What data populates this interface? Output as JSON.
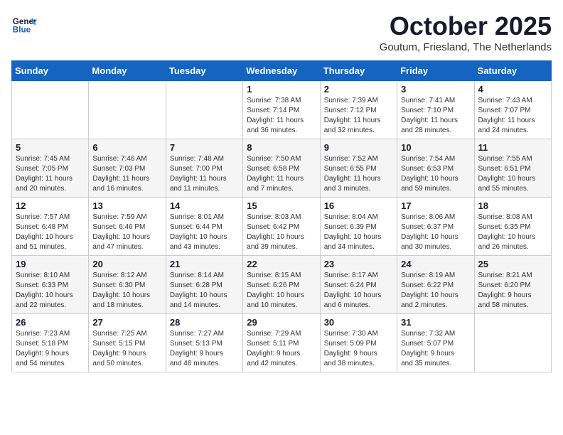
{
  "logo": {
    "line1": "General",
    "line2": "Blue"
  },
  "title": "October 2025",
  "location": "Goutum, Friesland, The Netherlands",
  "days_of_week": [
    "Sunday",
    "Monday",
    "Tuesday",
    "Wednesday",
    "Thursday",
    "Friday",
    "Saturday"
  ],
  "weeks": [
    [
      {
        "num": "",
        "info": ""
      },
      {
        "num": "",
        "info": ""
      },
      {
        "num": "",
        "info": ""
      },
      {
        "num": "1",
        "info": "Sunrise: 7:38 AM\nSunset: 7:14 PM\nDaylight: 11 hours\nand 36 minutes."
      },
      {
        "num": "2",
        "info": "Sunrise: 7:39 AM\nSunset: 7:12 PM\nDaylight: 11 hours\nand 32 minutes."
      },
      {
        "num": "3",
        "info": "Sunrise: 7:41 AM\nSunset: 7:10 PM\nDaylight: 11 hours\nand 28 minutes."
      },
      {
        "num": "4",
        "info": "Sunrise: 7:43 AM\nSunset: 7:07 PM\nDaylight: 11 hours\nand 24 minutes."
      }
    ],
    [
      {
        "num": "5",
        "info": "Sunrise: 7:45 AM\nSunset: 7:05 PM\nDaylight: 11 hours\nand 20 minutes."
      },
      {
        "num": "6",
        "info": "Sunrise: 7:46 AM\nSunset: 7:03 PM\nDaylight: 11 hours\nand 16 minutes."
      },
      {
        "num": "7",
        "info": "Sunrise: 7:48 AM\nSunset: 7:00 PM\nDaylight: 11 hours\nand 11 minutes."
      },
      {
        "num": "8",
        "info": "Sunrise: 7:50 AM\nSunset: 6:58 PM\nDaylight: 11 hours\nand 7 minutes."
      },
      {
        "num": "9",
        "info": "Sunrise: 7:52 AM\nSunset: 6:55 PM\nDaylight: 11 hours\nand 3 minutes."
      },
      {
        "num": "10",
        "info": "Sunrise: 7:54 AM\nSunset: 6:53 PM\nDaylight: 10 hours\nand 59 minutes."
      },
      {
        "num": "11",
        "info": "Sunrise: 7:55 AM\nSunset: 6:51 PM\nDaylight: 10 hours\nand 55 minutes."
      }
    ],
    [
      {
        "num": "12",
        "info": "Sunrise: 7:57 AM\nSunset: 6:48 PM\nDaylight: 10 hours\nand 51 minutes."
      },
      {
        "num": "13",
        "info": "Sunrise: 7:59 AM\nSunset: 6:46 PM\nDaylight: 10 hours\nand 47 minutes."
      },
      {
        "num": "14",
        "info": "Sunrise: 8:01 AM\nSunset: 6:44 PM\nDaylight: 10 hours\nand 43 minutes."
      },
      {
        "num": "15",
        "info": "Sunrise: 8:03 AM\nSunset: 6:42 PM\nDaylight: 10 hours\nand 39 minutes."
      },
      {
        "num": "16",
        "info": "Sunrise: 8:04 AM\nSunset: 6:39 PM\nDaylight: 10 hours\nand 34 minutes."
      },
      {
        "num": "17",
        "info": "Sunrise: 8:06 AM\nSunset: 6:37 PM\nDaylight: 10 hours\nand 30 minutes."
      },
      {
        "num": "18",
        "info": "Sunrise: 8:08 AM\nSunset: 6:35 PM\nDaylight: 10 hours\nand 26 minutes."
      }
    ],
    [
      {
        "num": "19",
        "info": "Sunrise: 8:10 AM\nSunset: 6:33 PM\nDaylight: 10 hours\nand 22 minutes."
      },
      {
        "num": "20",
        "info": "Sunrise: 8:12 AM\nSunset: 6:30 PM\nDaylight: 10 hours\nand 18 minutes."
      },
      {
        "num": "21",
        "info": "Sunrise: 8:14 AM\nSunset: 6:28 PM\nDaylight: 10 hours\nand 14 minutes."
      },
      {
        "num": "22",
        "info": "Sunrise: 8:15 AM\nSunset: 6:26 PM\nDaylight: 10 hours\nand 10 minutes."
      },
      {
        "num": "23",
        "info": "Sunrise: 8:17 AM\nSunset: 6:24 PM\nDaylight: 10 hours\nand 6 minutes."
      },
      {
        "num": "24",
        "info": "Sunrise: 8:19 AM\nSunset: 6:22 PM\nDaylight: 10 hours\nand 2 minutes."
      },
      {
        "num": "25",
        "info": "Sunrise: 8:21 AM\nSunset: 6:20 PM\nDaylight: 9 hours\nand 58 minutes."
      }
    ],
    [
      {
        "num": "26",
        "info": "Sunrise: 7:23 AM\nSunset: 5:18 PM\nDaylight: 9 hours\nand 54 minutes."
      },
      {
        "num": "27",
        "info": "Sunrise: 7:25 AM\nSunset: 5:15 PM\nDaylight: 9 hours\nand 50 minutes."
      },
      {
        "num": "28",
        "info": "Sunrise: 7:27 AM\nSunset: 5:13 PM\nDaylight: 9 hours\nand 46 minutes."
      },
      {
        "num": "29",
        "info": "Sunrise: 7:29 AM\nSunset: 5:11 PM\nDaylight: 9 hours\nand 42 minutes."
      },
      {
        "num": "30",
        "info": "Sunrise: 7:30 AM\nSunset: 5:09 PM\nDaylight: 9 hours\nand 38 minutes."
      },
      {
        "num": "31",
        "info": "Sunrise: 7:32 AM\nSunset: 5:07 PM\nDaylight: 9 hours\nand 35 minutes."
      },
      {
        "num": "",
        "info": ""
      }
    ]
  ]
}
